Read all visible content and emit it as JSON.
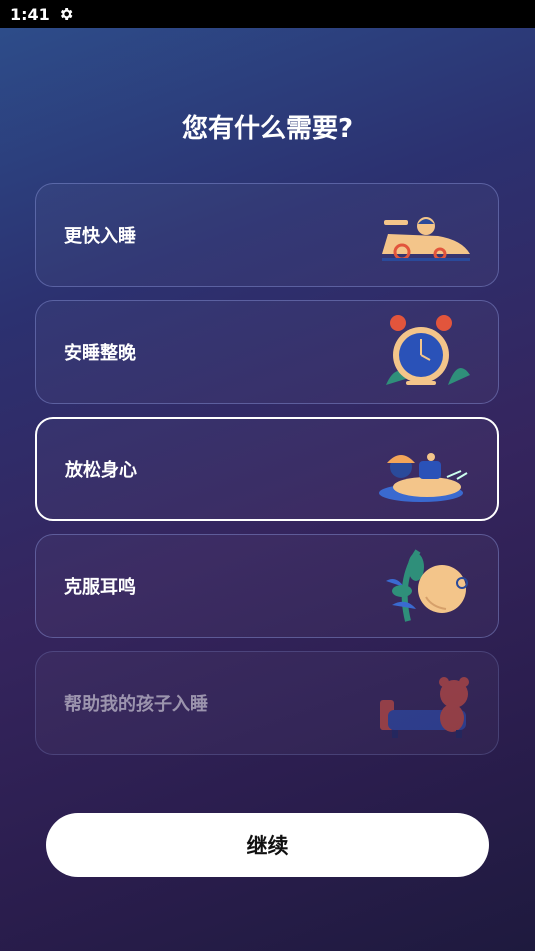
{
  "status_bar": {
    "time": "1:41",
    "icon": "gear-icon"
  },
  "title": "您有什么需要?",
  "options": [
    {
      "label": "更快入睡",
      "icon": "race-car-illustration"
    },
    {
      "label": "安睡整晚",
      "icon": "alarm-clock-illustration"
    },
    {
      "label": "放松身心",
      "icon": "float-relax-illustration",
      "selected": true
    },
    {
      "label": "克服耳鸣",
      "icon": "ear-plants-illustration"
    },
    {
      "label": "帮助我的孩子入睡",
      "icon": "teddy-bear-bed-illustration"
    }
  ],
  "continue_label": "继续",
  "colors": {
    "accent": "#ffffff",
    "background_top": "#2d4f8c",
    "background_bottom": "#1e1a3e"
  }
}
